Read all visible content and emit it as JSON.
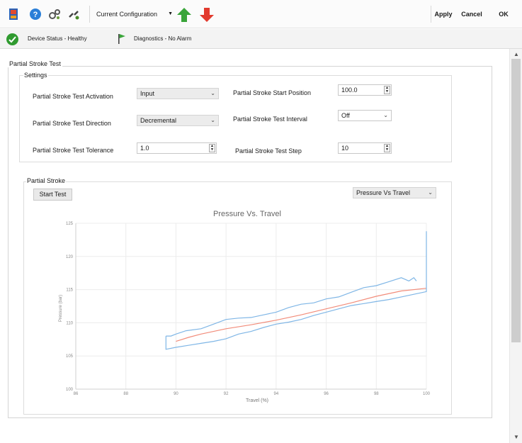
{
  "toolbar": {
    "items": [
      "device-icon",
      "help-icon",
      "settings-icon",
      "link-icon"
    ],
    "configuration": "Current Configuration",
    "apply": "Apply",
    "cancel": "Cancel",
    "ok": "OK"
  },
  "status": {
    "device": "Device Status - Healthy",
    "diagnostics": "Diagnostics - No Alarm"
  },
  "panel": {
    "title": "Partial Stroke Test",
    "settings": {
      "title": "Settings",
      "activation_label": "Partial Stroke Test Activation",
      "activation_value": "Input",
      "direction_label": "Partial Stroke Test Direction",
      "direction_value": "Decremental",
      "tolerance_label": "Partial Stroke Test Tolerance",
      "tolerance_value": "1.0",
      "start_position_label": "Partial Stroke Start Position",
      "start_position_value": "100.0",
      "interval_label": "Partial Stroke Test Interval",
      "interval_value": "Off",
      "step_label": "Partial Stroke Test Step",
      "step_value": "10"
    },
    "stroke": {
      "title": "Partial Stroke",
      "start_test": "Start Test",
      "plot_select": "Pressure Vs Travel"
    }
  },
  "colors": {
    "accent_green": "#2f9a2f",
    "arrow_up": "#3aa53a",
    "arrow_down": "#e23a2e",
    "band_line": "#7fb6e6",
    "mean_line": "#f28c7a"
  },
  "chart_data": {
    "type": "line",
    "title": "Pressure Vs. Travel",
    "xlabel": "Travel (%)",
    "ylabel": "Pressure (bar)",
    "xlim": [
      86,
      100
    ],
    "ylim": [
      100,
      125
    ],
    "x_ticks": [
      86,
      88,
      90,
      92,
      94,
      96,
      98,
      100
    ],
    "y_ticks": [
      100,
      105,
      110,
      115,
      120,
      125
    ],
    "grid": true,
    "series": [
      {
        "values": [
          [
            89.6,
            108.0
          ],
          [
            89.8,
            108.0
          ],
          [
            90.0,
            108.3
          ],
          [
            90.4,
            108.8
          ],
          [
            91.0,
            109.1
          ],
          [
            91.5,
            109.8
          ],
          [
            92.0,
            110.5
          ],
          [
            92.5,
            110.7
          ],
          [
            93.0,
            110.8
          ],
          [
            93.5,
            111.2
          ],
          [
            94.0,
            111.6
          ],
          [
            94.5,
            112.3
          ],
          [
            95.0,
            112.8
          ],
          [
            95.5,
            113.0
          ],
          [
            96.0,
            113.6
          ],
          [
            96.5,
            113.9
          ],
          [
            97.0,
            114.6
          ],
          [
            97.5,
            115.3
          ],
          [
            98.0,
            115.6
          ],
          [
            98.5,
            116.2
          ],
          [
            99.0,
            116.8
          ],
          [
            99.3,
            116.3
          ],
          [
            99.5,
            116.8
          ],
          [
            99.6,
            116.3
          ]
        ],
        "color": "#7fb6e6"
      },
      {
        "values": [
          [
            90.0,
            107.2
          ],
          [
            90.5,
            107.8
          ],
          [
            91.0,
            108.3
          ],
          [
            92.0,
            109.1
          ],
          [
            93.0,
            109.7
          ],
          [
            94.0,
            110.4
          ],
          [
            95.0,
            111.2
          ],
          [
            96.0,
            112.1
          ],
          [
            97.0,
            113.0
          ],
          [
            98.0,
            114.0
          ],
          [
            99.0,
            114.8
          ],
          [
            100.0,
            115.2
          ]
        ],
        "color": "#f28c7a"
      },
      {
        "values": [
          [
            89.6,
            108.0
          ],
          [
            89.6,
            106.0
          ],
          [
            90.0,
            106.3
          ],
          [
            90.5,
            106.6
          ],
          [
            91.0,
            106.9
          ],
          [
            91.5,
            107.2
          ],
          [
            92.0,
            107.6
          ],
          [
            92.5,
            108.3
          ],
          [
            93.0,
            108.7
          ],
          [
            93.5,
            109.3
          ],
          [
            94.0,
            109.8
          ],
          [
            94.5,
            110.1
          ],
          [
            95.0,
            110.5
          ],
          [
            95.5,
            111.1
          ],
          [
            96.0,
            111.6
          ],
          [
            96.5,
            112.1
          ],
          [
            97.0,
            112.6
          ],
          [
            97.5,
            112.9
          ],
          [
            98.0,
            113.2
          ],
          [
            98.5,
            113.5
          ],
          [
            99.0,
            113.9
          ],
          [
            99.5,
            114.3
          ],
          [
            100.0,
            114.7
          ],
          [
            100.0,
            123.8
          ]
        ],
        "color": "#7fb6e6"
      }
    ]
  }
}
